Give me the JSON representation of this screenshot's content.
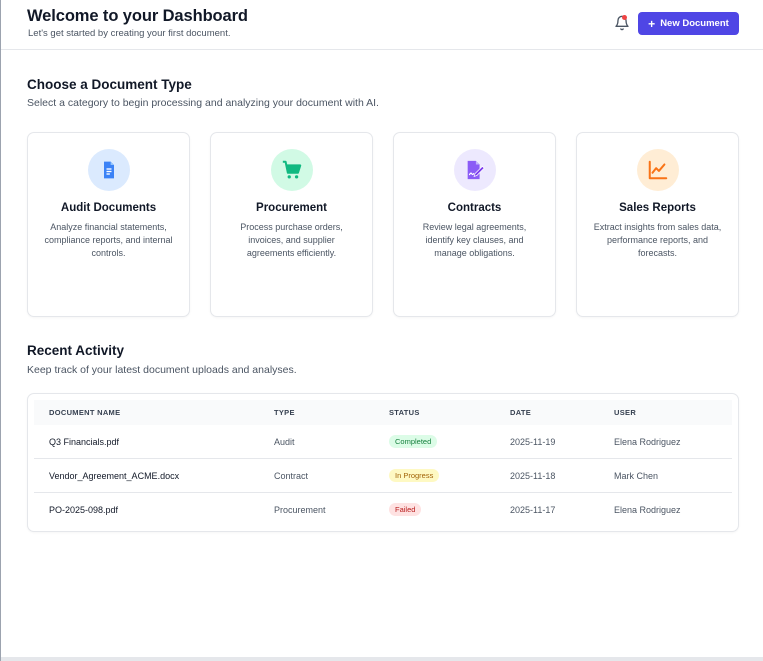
{
  "header": {
    "title": "Welcome to your Dashboard",
    "subtitle": "Let's get started by creating your first document.",
    "new_document_label": "New Document"
  },
  "document_types": {
    "title": "Choose a Document Type",
    "subtitle": "Select a category to begin processing and analyzing your document with AI.",
    "cards": [
      {
        "title": "Audit Documents",
        "description": "Analyze financial statements, compliance reports, and internal controls.",
        "icon": "document-icon",
        "color": "#3b82f6",
        "bg": "#dbeafe"
      },
      {
        "title": "Procurement",
        "description": "Process purchase orders, invoices, and supplier agreements efficiently.",
        "icon": "cart-icon",
        "color": "#10b981",
        "bg": "#d1fae5"
      },
      {
        "title": "Contracts",
        "description": "Review legal agreements, identify key clauses, and manage obligations.",
        "icon": "contract-sign-icon",
        "color": "#8b5cf6",
        "bg": "#ede9fe"
      },
      {
        "title": "Sales Reports",
        "description": "Extract insights from sales data, performance reports, and forecasts.",
        "icon": "line-chart-icon",
        "color": "#f97316",
        "bg": "#ffedd5"
      }
    ]
  },
  "recent_activity": {
    "title": "Recent Activity",
    "subtitle": "Keep track of your latest document uploads and analyses.",
    "columns": [
      "DOCUMENT NAME",
      "TYPE",
      "STATUS",
      "DATE",
      "USER"
    ],
    "rows": [
      {
        "name": "Q3 Financials.pdf",
        "type": "Audit",
        "status": "Completed",
        "date": "2025-11-19",
        "user": "Elena Rodriguez"
      },
      {
        "name": "Vendor_Agreement_ACME.docx",
        "type": "Contract",
        "status": "In Progress",
        "date": "2025-11-18",
        "user": "Mark Chen"
      },
      {
        "name": "PO-2025-098.pdf",
        "type": "Procurement",
        "status": "Failed",
        "date": "2025-11-17",
        "user": "Elena Rodriguez"
      }
    ]
  },
  "colors": {
    "accent": "#4f46e5",
    "notification_dot": "#ef4444"
  }
}
